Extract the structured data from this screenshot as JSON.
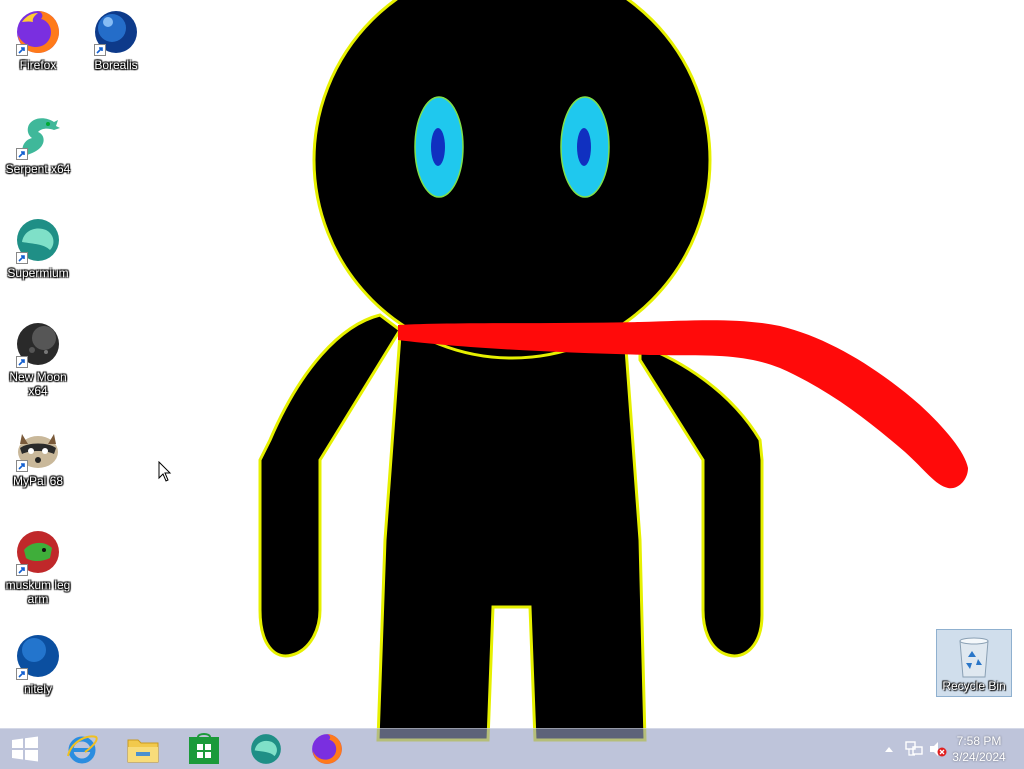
{
  "desktop": {
    "icons": [
      {
        "label": "Firefox",
        "icon": "firefox-icon"
      },
      {
        "label": "Borealis",
        "icon": "borealis-icon"
      },
      {
        "label": "Serpent x64",
        "icon": "serpent-icon"
      },
      {
        "label": "Supermium",
        "icon": "supermium-icon"
      },
      {
        "label": "New Moon x64",
        "icon": "new-moon-icon"
      },
      {
        "label": "MyPal 68",
        "icon": "mypal-icon"
      },
      {
        "label": "muskum leg arm",
        "icon": "muskum-icon"
      },
      {
        "label": "nitely",
        "icon": "nitely-icon"
      }
    ],
    "recycle_bin": {
      "label": "Recycle Bin",
      "icon": "recycle-bin-icon"
    }
  },
  "taskbar": {
    "start": {
      "icon": "windows-start-icon"
    },
    "pinned": [
      {
        "icon": "internet-explorer-icon"
      },
      {
        "icon": "file-explorer-icon"
      },
      {
        "icon": "store-icon"
      },
      {
        "icon": "supermium-icon"
      },
      {
        "icon": "firefox-icon"
      }
    ],
    "tray": {
      "icons": [
        "show-hidden-icons-icon",
        "network-icon",
        "volume-muted-icon"
      ]
    },
    "clock": {
      "time": "7:58 PM",
      "date": "3/24/2024"
    }
  },
  "colors": {
    "wallpaper_bg": "#ffffff",
    "figure_body": "#000000",
    "figure_outline": "#e6f000",
    "eye_outer": "#1fc8ee",
    "eye_pupil": "#1030c0",
    "scarf": "#ff0a0a",
    "taskbar": "#9aa0c3"
  }
}
